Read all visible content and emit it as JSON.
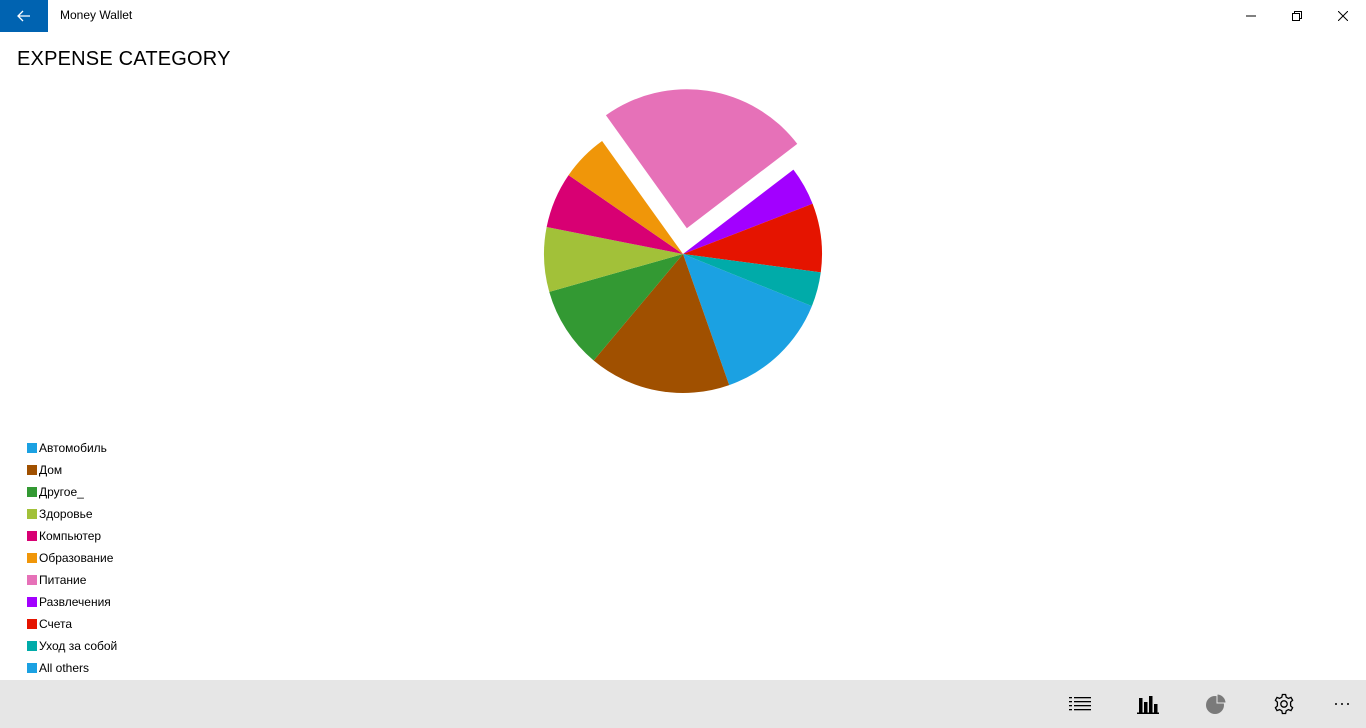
{
  "titlebar": {
    "app_title": "Money Wallet",
    "back_icon": "arrow-left-icon",
    "minimize_icon": "minimize-icon",
    "restore_icon": "restore-icon",
    "close_icon": "close-icon",
    "accent": "#0063b1"
  },
  "page": {
    "title": "EXPENSE CATEGORY"
  },
  "chart_data": {
    "type": "pie",
    "exploded": "Питание",
    "categories": [
      "Автомобиль",
      "Дом",
      "Другое_",
      "Здоровье",
      "Компьютер",
      "Образование",
      "Питание",
      "Развлечения",
      "Счета",
      "Уход за собой",
      "All others"
    ],
    "values": [
      13.5,
      16.5,
      9.5,
      7.5,
      6.5,
      5.5,
      24.5,
      4.5,
      8.0,
      4.0,
      0.0
    ],
    "colors": [
      "#1ba1e2",
      "#a05000",
      "#339933",
      "#a2c139",
      "#d80073",
      "#f09609",
      "#e671b8",
      "#a200ff",
      "#e51400",
      "#00aba9",
      "#1ba1e2"
    ],
    "legend_position": "bottom-left"
  },
  "bottom_bar": {
    "buttons": [
      {
        "icon": "list-icon"
      },
      {
        "icon": "bar-chart-icon"
      },
      {
        "icon": "pie-chart-icon"
      },
      {
        "icon": "gear-icon"
      },
      {
        "icon": "more-icon"
      }
    ],
    "background": "#e6e6e6"
  }
}
